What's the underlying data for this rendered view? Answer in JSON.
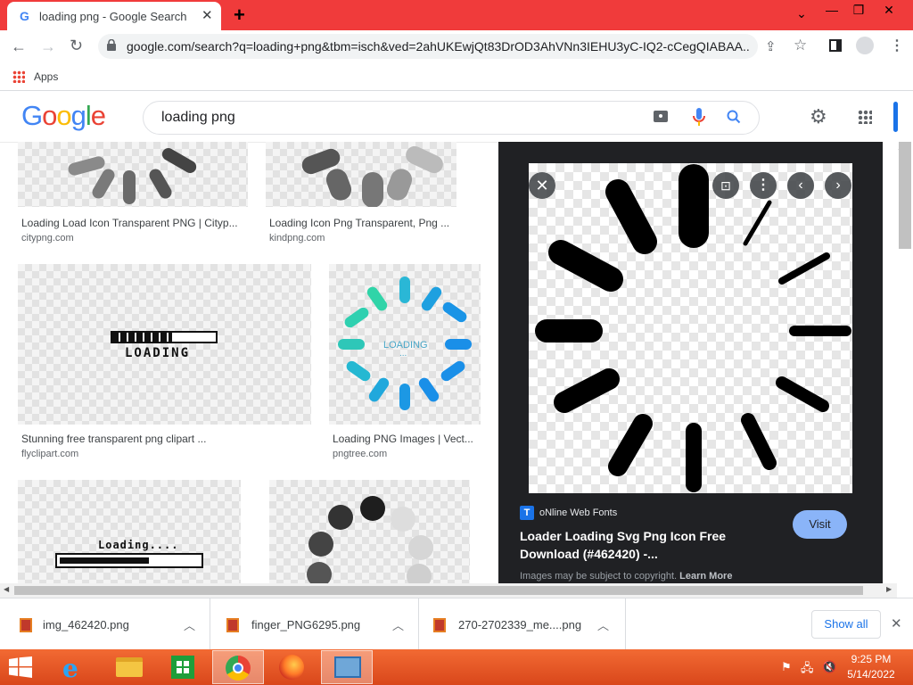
{
  "browser": {
    "tab_title": "loading png - Google Search",
    "url": "google.com/search?q=loading+png&tbm=isch&ved=2ahUKEwjQt83DrOD3AhVNn3IEHU3yC-IQ2-cCegQIABAA...",
    "bookmarks_apps_label": "Apps"
  },
  "google": {
    "logo_letters": [
      "G",
      "o",
      "o",
      "g",
      "l",
      "e"
    ],
    "logo_colors": [
      "#4285F4",
      "#EA4335",
      "#FBBC05",
      "#4285F4",
      "#34A853",
      "#EA4335"
    ],
    "search_query": "loading png"
  },
  "results": [
    {
      "title": "Loading Load Icon Transparent PNG | Cityp...",
      "site": "citypng.com"
    },
    {
      "title": "Loading Icon Png Transparent, Png ...",
      "site": "kindpng.com"
    },
    {
      "title": "Stunning free transparent png clipart ...",
      "site": "flyclipart.com"
    },
    {
      "title": "Loading PNG Images | Vect...",
      "site": "pngtree.com"
    }
  ],
  "result_thumbs": {
    "pixel_loading_text": "LOADING",
    "teal_loading_text": "LOADING",
    "teal_dots": "...",
    "loading_bar_text": "Loading...."
  },
  "preview_panel": {
    "source_name": "oNline Web Fonts",
    "source_icon_letter": "T",
    "title": "Loader Loading Svg Png Icon Free Download (#462420) -...",
    "visit_label": "Visit",
    "copyright_text": "Images may be subject to copyright.",
    "learn_more_label": "Learn More"
  },
  "downloads": {
    "items": [
      {
        "name": "img_462420.png"
      },
      {
        "name": "finger_PNG6295.png"
      },
      {
        "name": "270-2702339_me....png"
      }
    ],
    "show_all_label": "Show all"
  },
  "taskbar": {
    "time": "9:25 PM",
    "date": "5/14/2022"
  }
}
